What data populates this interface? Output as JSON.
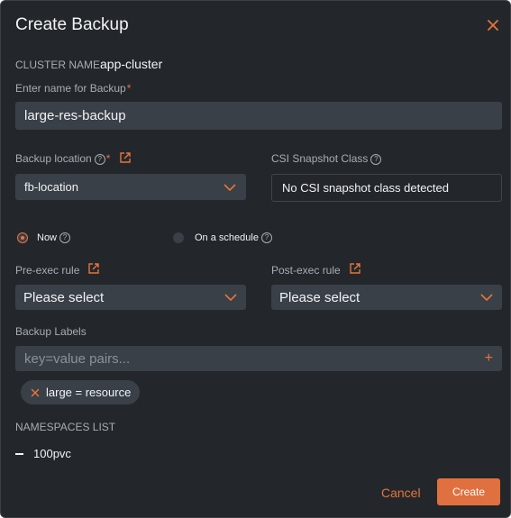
{
  "dialog": {
    "title": "Create Backup"
  },
  "cluster": {
    "label": "CLUSTER NAME:",
    "value": "app-cluster"
  },
  "backup_name": {
    "label": "Enter name for Backup",
    "required_mark": "*",
    "value": "large-res-backup"
  },
  "backup_location": {
    "label": "Backup location",
    "required_mark": "*",
    "selected": "fb-location"
  },
  "csi_snapshot": {
    "label": "CSI Snapshot Class",
    "value": "No CSI snapshot class detected"
  },
  "schedule": {
    "options": [
      "Now",
      "On a schedule"
    ],
    "selected": "Now"
  },
  "pre_exec": {
    "label": "Pre-exec rule",
    "selected": "Please select"
  },
  "post_exec": {
    "label": "Post-exec rule",
    "selected": "Please select"
  },
  "labels": {
    "label": "Backup Labels",
    "placeholder": "key=value pairs...",
    "add_symbol": "+",
    "chips": [
      "large = resource"
    ]
  },
  "namespaces": {
    "label": "NAMESPACES LIST",
    "items": [
      "100pvc"
    ]
  },
  "actions": {
    "cancel": "Cancel",
    "create": "Create"
  },
  "colors": {
    "accent": "#e8743b",
    "background": "#23272b",
    "field": "#3a4047",
    "primary_button": "#e0703f"
  },
  "icons": [
    "close-icon",
    "help-icon",
    "external-link-icon",
    "chevron-down-icon",
    "plus-icon",
    "remove-chip-icon",
    "collapse-icon"
  ]
}
